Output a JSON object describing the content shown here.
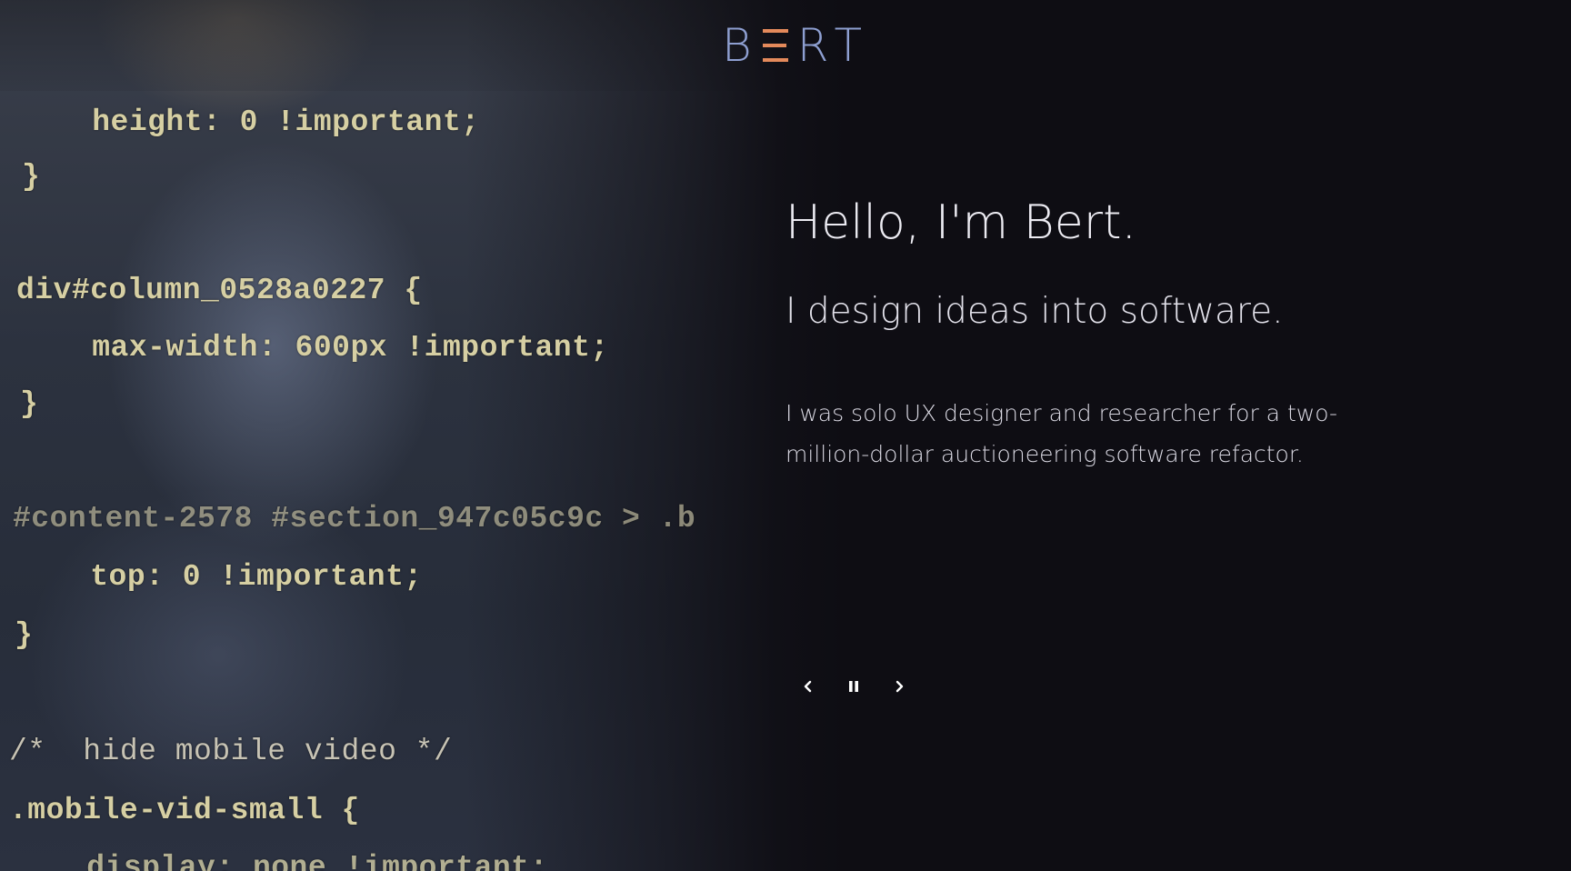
{
  "brand": {
    "logo_letters": [
      "B",
      "R",
      "T"
    ],
    "logo_text": "BERT",
    "colors": {
      "logo_primary": "#8e9fd1",
      "logo_accent": "#e48a5b",
      "background": "#0e0d13",
      "text": "#ecebf2",
      "code_text": "#d6cfa3"
    }
  },
  "hero": {
    "greeting": "Hello, I'm Bert.",
    "tagline": "I design ideas into software.",
    "description": "I was solo UX designer and researcher for a two-million-dollar auctioneering software refactor."
  },
  "background_code": {
    "lines": [
      "    height: 0 !important;",
      "}",
      "div#column_0528a0227 {",
      "    max-width: 600px !important;",
      "}",
      "#content-2578 #section_947c05c9c > .b",
      "    top: 0 !important;",
      "}",
      "/*  hide mobile video */",
      ".mobile-vid-small {",
      "    display: none !important;"
    ]
  },
  "carousel": {
    "prev_icon": "chevron-left-icon",
    "pause_icon": "pause-icon",
    "next_icon": "chevron-right-icon"
  }
}
